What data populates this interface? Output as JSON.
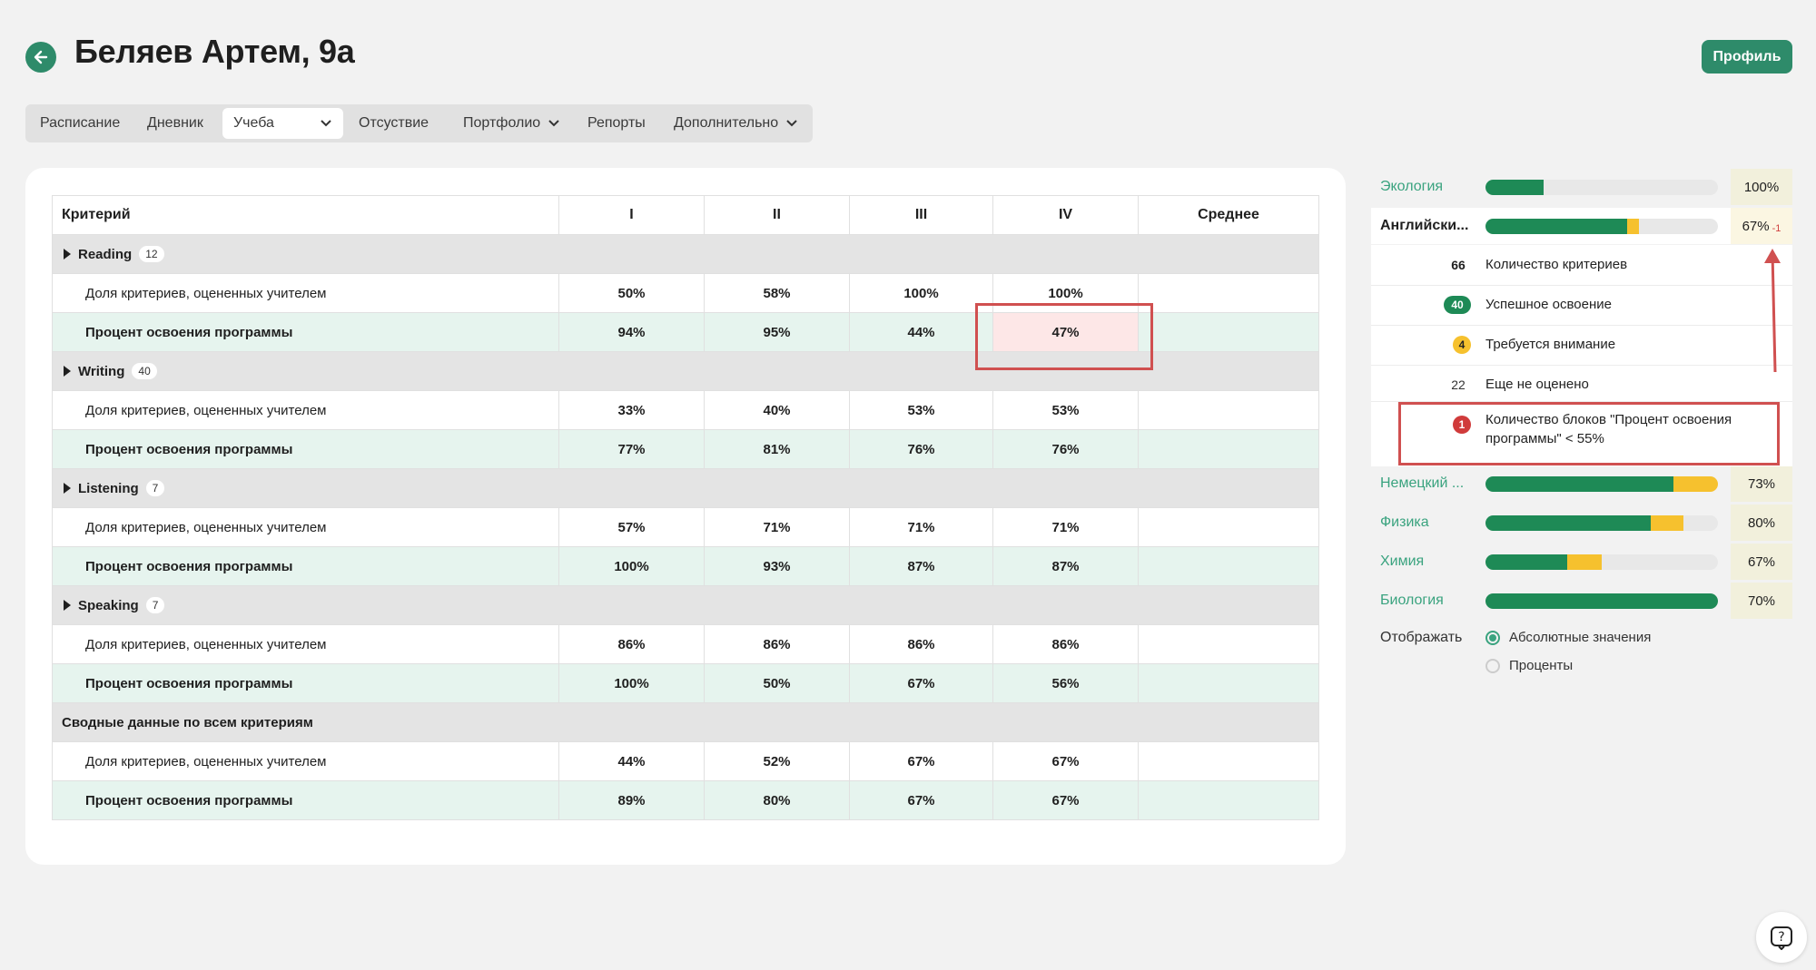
{
  "header": {
    "title": "Беляев Артем, 9а",
    "profile_label": "Профиль"
  },
  "tabs": [
    {
      "label": "Расписание"
    },
    {
      "label": "Дневник"
    },
    {
      "label": "Учеба"
    },
    {
      "label": "Отсуствие"
    },
    {
      "label": "Портфолио"
    },
    {
      "label": "Репорты"
    },
    {
      "label": "Дополнительно"
    }
  ],
  "table": {
    "headers": [
      "Критерий",
      "I",
      "II",
      "III",
      "IV",
      "Среднее"
    ],
    "groups": [
      {
        "name": "Reading",
        "count": "12",
        "share": {
          "label": "Доля критериев, оцененных учителем",
          "values": [
            "50%",
            "58%",
            "100%",
            "100%",
            ""
          ]
        },
        "prog": {
          "label": "Процент освоения программы",
          "values": [
            "94%",
            "95%",
            "44%",
            "47%",
            ""
          ]
        }
      },
      {
        "name": "Writing",
        "count": "40",
        "share": {
          "label": "Доля критериев, оцененных учителем",
          "values": [
            "33%",
            "40%",
            "53%",
            "53%",
            ""
          ]
        },
        "prog": {
          "label": "Процент освоения программы",
          "values": [
            "77%",
            "81%",
            "76%",
            "76%",
            ""
          ]
        }
      },
      {
        "name": "Listening",
        "count": "7",
        "share": {
          "label": "Доля критериев, оцененных учителем",
          "values": [
            "57%",
            "71%",
            "71%",
            "71%",
            ""
          ]
        },
        "prog": {
          "label": "Процент освоения программы",
          "values": [
            "100%",
            "93%",
            "87%",
            "87%",
            ""
          ]
        }
      },
      {
        "name": "Speaking",
        "count": "7",
        "share": {
          "label": "Доля критериев, оцененных учителем",
          "values": [
            "86%",
            "86%",
            "86%",
            "86%",
            ""
          ]
        },
        "prog": {
          "label": "Процент освоения программы",
          "values": [
            "100%",
            "50%",
            "67%",
            "56%",
            ""
          ]
        }
      }
    ],
    "summary": {
      "name": "Сводные данные по всем критериям",
      "share": {
        "label": "Доля критериев, оцененных учителем",
        "values": [
          "44%",
          "52%",
          "67%",
          "67%",
          ""
        ]
      },
      "prog": {
        "label": "Процент освоения программы",
        "values": [
          "89%",
          "80%",
          "67%",
          "67%",
          ""
        ]
      }
    }
  },
  "subjects": [
    {
      "name": "Экология",
      "green": 0.25,
      "yellow": 0,
      "pct": "100%",
      "sup": ""
    },
    {
      "name": "Английски...",
      "green": 0.61,
      "yellow": 0.05,
      "pct": "67%",
      "sup": "-1"
    },
    {
      "name": "Немецкий ...",
      "green": 0.81,
      "yellow": 0.19,
      "pct": "73%",
      "sup": ""
    },
    {
      "name": "Физика",
      "green": 0.71,
      "yellow": 0.14,
      "pct": "80%",
      "sup": ""
    },
    {
      "name": "Химия",
      "green": 0.35,
      "yellow": 0.15,
      "pct": "67%",
      "sup": ""
    },
    {
      "name": "Биология",
      "green": 1.0,
      "yellow": 0,
      "pct": "70%",
      "sup": ""
    }
  ],
  "details": [
    {
      "num": "66",
      "kind": "plain",
      "text": "Количество критериев"
    },
    {
      "num": "40",
      "kind": "green",
      "text": "Успешное освоение"
    },
    {
      "num": "4",
      "kind": "yellow",
      "text": "Требуется внимание"
    },
    {
      "num": "22",
      "kind": "plain-light",
      "text": "Еще не оценено"
    },
    {
      "num": "1",
      "kind": "red",
      "text": "Количество блоков \"Процент освоения программы\" < 55%"
    }
  ],
  "display": {
    "label": "Отображать",
    "options": [
      {
        "label": "Абсолютные значения",
        "selected": true
      },
      {
        "label": "Проценты",
        "selected": false
      }
    ]
  },
  "colors": {
    "accent": "#2e8b6a",
    "bar_green": "#1e8a56",
    "bar_yellow": "#f6c12e",
    "alert_red": "#d03b3b"
  }
}
